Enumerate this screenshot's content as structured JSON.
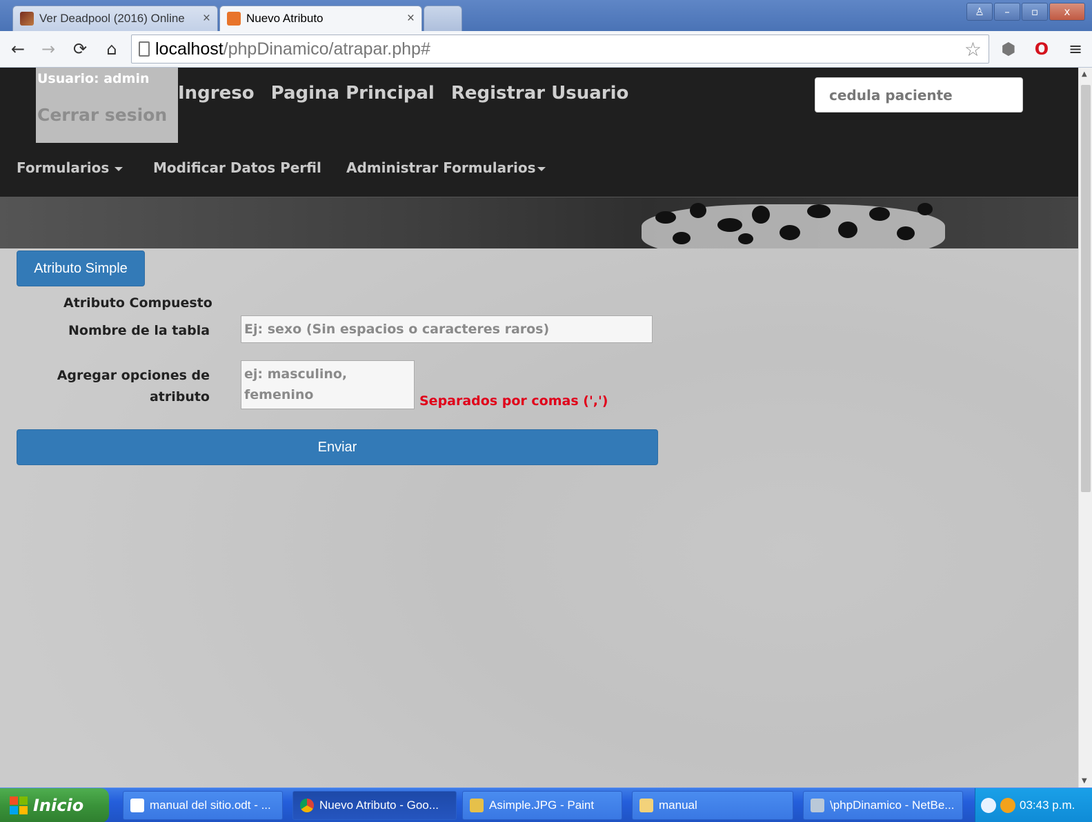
{
  "browser": {
    "tabs": [
      {
        "title": "Ver Deadpool (2016) Online",
        "close": "×"
      },
      {
        "title": "Nuevo Atributo",
        "close": "×"
      }
    ],
    "url_host": "localhost",
    "url_path": "/phpDinamico/atrapar.php#",
    "window_buttons": [
      "♙",
      "–",
      "▫",
      "x"
    ]
  },
  "header": {
    "user_label": "Usuario: admin",
    "logout_label": "Cerrar sesion",
    "links": [
      "Ingreso",
      "Pagina Principal",
      "Registrar Usuario"
    ],
    "search_placeholder": "cedula paciente"
  },
  "menu": {
    "formularios": "Formularios",
    "modificar": "Modificar Datos Perfil",
    "administrar": "Administrar Formularios"
  },
  "form": {
    "simple_button": "Atributo Simple",
    "compuesto_label": "Atributo Compuesto",
    "table_name_label": "Nombre de la tabla",
    "table_name_placeholder": "Ej: sexo (Sin espacios o caracteres raros)",
    "options_label_1": "Agregar opciones de",
    "options_label_2": "atributo",
    "options_placeholder": "ej: masculino, femenino",
    "options_hint": "Separados por comas (',')",
    "submit_button": "Enviar"
  },
  "taskbar": {
    "start": "Inicio",
    "items": [
      "manual del sitio.odt - ...",
      "Nuevo Atributo - Goo...",
      "Asimple.JPG - Paint",
      "manual",
      "\\phpDinamico - NetBe..."
    ],
    "clock": "03:43 p.m."
  },
  "colors": {
    "primary": "#337ab7",
    "navbar": "#1f1f1f",
    "hint": "#e0001a",
    "page_bg": "#cacaca"
  }
}
